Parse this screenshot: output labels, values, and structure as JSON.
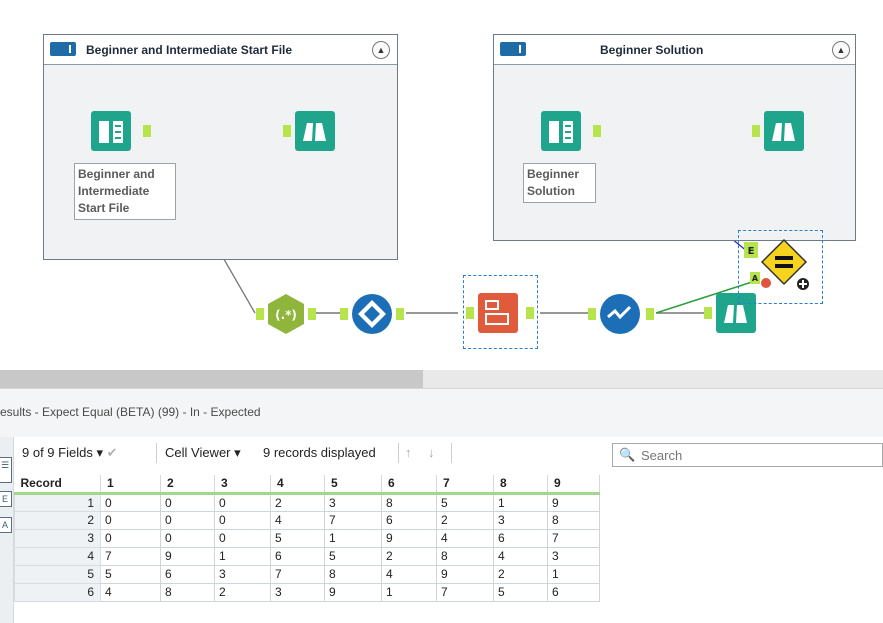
{
  "workflow": {
    "containers": [
      {
        "title": "Beginner and  Intermediate Start File"
      },
      {
        "title": "Beginner Solution"
      }
    ],
    "labels": {
      "start_file": [
        "Beginner and",
        "Intermediate",
        "Start File"
      ],
      "solution": [
        "Beginner",
        "Solution"
      ]
    },
    "tools": [
      "input-data-tool",
      "browse-tool",
      "regex-tool",
      "transpose-tool",
      "formula-tool",
      "select-tool",
      "expect-equal-tool"
    ],
    "anchors": {
      "e": "E",
      "a": "A"
    },
    "colors": {
      "green_tool": "#1fa58b",
      "blue_tool": "#1c6fb7",
      "hex_tool": "#8fb53a",
      "orange_tool": "#e05a3c",
      "yellow_tool": "#f5d31f",
      "connector_blue": "#2b2bd6",
      "connector_green": "#2e9d3e"
    }
  },
  "results": {
    "title": "esults - Expect Equal (BETA) (99) - In - Expected",
    "fields_label": "9 of 9 Fields",
    "viewer_label": "Cell Viewer",
    "records_label": "9 records displayed",
    "search_placeholder": "Search",
    "strip_icons": [
      "E",
      "A"
    ],
    "columns": [
      "Record",
      "1",
      "2",
      "3",
      "4",
      "5",
      "6",
      "7",
      "8",
      "9"
    ],
    "rows": [
      [
        "1",
        "0",
        "0",
        "0",
        "2",
        "3",
        "8",
        "5",
        "1",
        "9"
      ],
      [
        "2",
        "0",
        "0",
        "0",
        "4",
        "7",
        "6",
        "2",
        "3",
        "8"
      ],
      [
        "3",
        "0",
        "0",
        "0",
        "5",
        "1",
        "9",
        "4",
        "6",
        "7"
      ],
      [
        "4",
        "7",
        "9",
        "1",
        "6",
        "5",
        "2",
        "8",
        "4",
        "3"
      ],
      [
        "5",
        "5",
        "6",
        "3",
        "7",
        "8",
        "4",
        "9",
        "2",
        "1"
      ],
      [
        "6",
        "4",
        "8",
        "2",
        "3",
        "9",
        "1",
        "7",
        "5",
        "6"
      ]
    ]
  }
}
